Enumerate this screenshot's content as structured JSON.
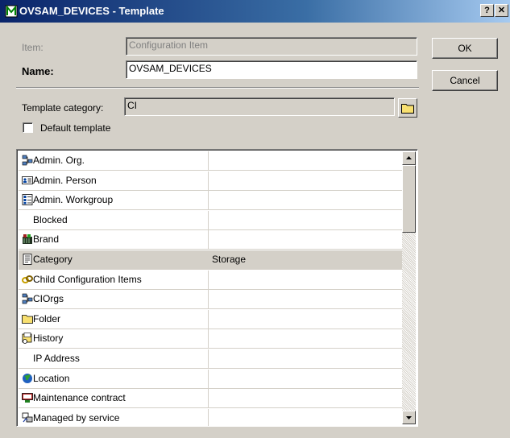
{
  "window": {
    "title": "OVSAM_DEVICES - Template",
    "help": "?",
    "close": "✕"
  },
  "form": {
    "item_label": "Item:",
    "item_value": "Configuration Item",
    "name_label": "Name:",
    "name_value": "OVSAM_DEVICES",
    "category_label": "Template category:",
    "category_value": "CI",
    "default_template_label": "Default template",
    "default_template_checked": false
  },
  "buttons": {
    "ok": "OK",
    "cancel": "Cancel"
  },
  "rows": [
    {
      "label": "Admin. Org.",
      "icon": "org-icon",
      "value": ""
    },
    {
      "label": "Admin. Person",
      "icon": "person-card-icon",
      "value": ""
    },
    {
      "label": "Admin. Workgroup",
      "icon": "workgroup-icon",
      "value": ""
    },
    {
      "label": "Blocked",
      "icon": "",
      "value": ""
    },
    {
      "label": "Brand",
      "icon": "brand-icon",
      "value": ""
    },
    {
      "label": "Category",
      "icon": "category-icon",
      "value": "Storage"
    },
    {
      "label": "Child Configuration Items",
      "icon": "chain-icon",
      "value": ""
    },
    {
      "label": "CIOrgs",
      "icon": "org-icon",
      "value": ""
    },
    {
      "label": "Folder",
      "icon": "folder-icon",
      "value": ""
    },
    {
      "label": "History",
      "icon": "history-icon",
      "value": ""
    },
    {
      "label": "IP Address",
      "icon": "",
      "value": ""
    },
    {
      "label": "Location",
      "icon": "globe-icon",
      "value": ""
    },
    {
      "label": "Maintenance contract",
      "icon": "contract-icon",
      "value": ""
    },
    {
      "label": "Managed by service",
      "icon": "service-icon",
      "value": ""
    }
  ],
  "selected_row": 5,
  "colors": {
    "title_start": "#0a246a",
    "title_end": "#a6caf0",
    "face": "#d4d0c8",
    "folder": "#f8e070"
  }
}
